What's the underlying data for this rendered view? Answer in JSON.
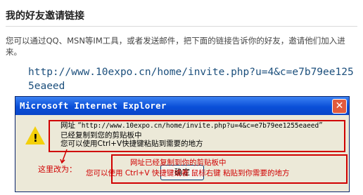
{
  "page": {
    "title": "我的好友邀请链接",
    "intro": "您可以通过QQ、MSN等IM工具，或者发送邮件，把下面的链接告诉你的好友，邀请他们加入进来。",
    "invite_url": "http://www.10expo.cn/home/invite.php?u=4&c=e7b79ee1255eaeed"
  },
  "dialog": {
    "title": "Microsoft Internet Explorer",
    "close_symbol": "✕",
    "icon": "warning-icon",
    "message_line1_label": "网址 “",
    "message_line1_url": "http://www.10expo.cn/home/invite.php?u=4&c=e7b79ee1255eaeed",
    "message_line1_end": "”",
    "message_line2": "已经复制到您的剪贴板中",
    "message_line3": "您可以使用Ctrl+V快捷键粘贴到需要的地方",
    "ok_label": "确定"
  },
  "annotation": {
    "label": "这里改为：",
    "line1": "网址已经复制到你的剪贴板中",
    "line2": "您可以使用 Ctrl+V 快捷键或者 鼠标右键 粘贴到你需要的地方",
    "color": "#d00000"
  }
}
